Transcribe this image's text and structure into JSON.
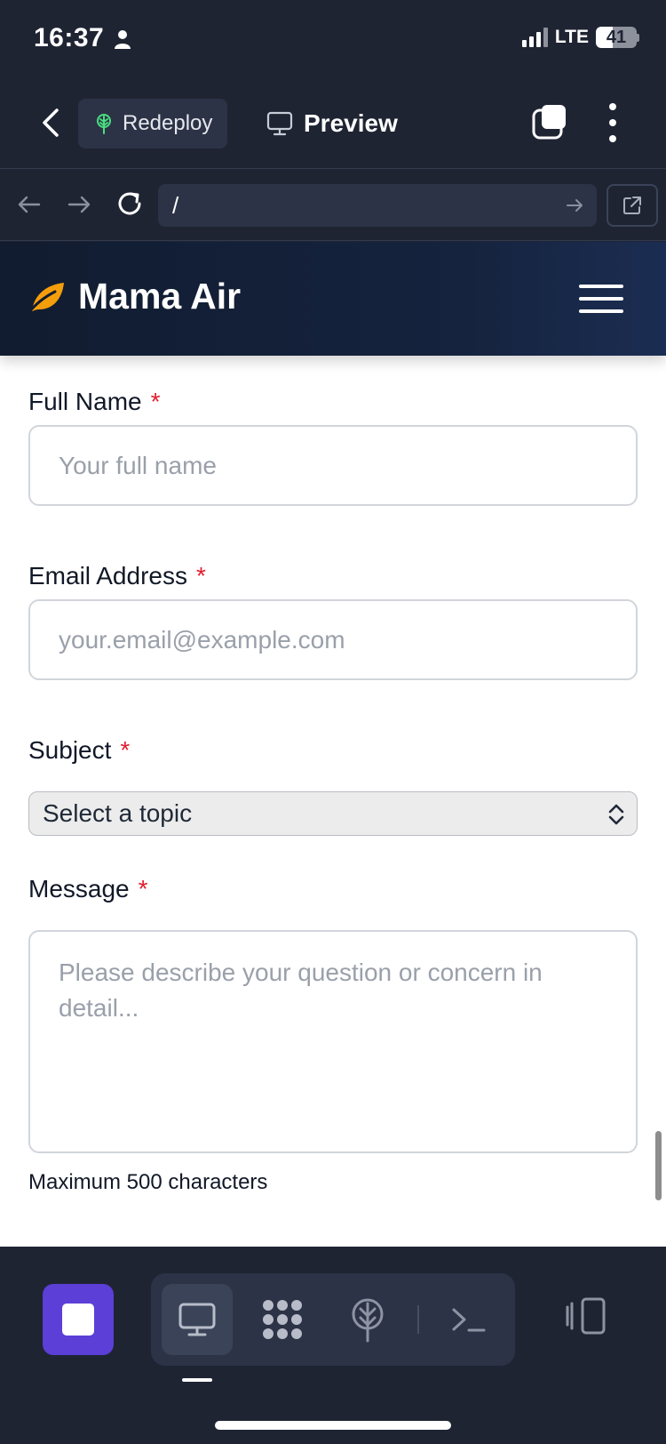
{
  "status_bar": {
    "time": "16:37",
    "network": "LTE",
    "battery_level": "41",
    "battery_fraction": 0.41
  },
  "toolbar": {
    "redeploy_label": "Redeploy",
    "preview_label": "Preview"
  },
  "url_bar": {
    "value": "/"
  },
  "site": {
    "brand_name": "Mama Air",
    "accent_color": "#f59e0b"
  },
  "form": {
    "full_name": {
      "label": "Full Name",
      "required_mark": "*",
      "placeholder": "Your full name"
    },
    "email": {
      "label": "Email Address",
      "required_mark": "*",
      "placeholder": "your.email@example.com"
    },
    "subject": {
      "label": "Subject",
      "required_mark": "*",
      "selected": "Select a topic"
    },
    "message": {
      "label": "Message",
      "required_mark": "*",
      "placeholder": "Please describe your question or concern in detail...",
      "helper": "Maximum 500 characters"
    }
  },
  "bottom_bar": {
    "stop_color": "#5b3fd6",
    "tools": [
      "monitor-icon",
      "grid-icon",
      "deploy-icon",
      "terminal-icon"
    ]
  },
  "colors": {
    "app_bg": "#1f2433",
    "required": "#e11d2e"
  }
}
